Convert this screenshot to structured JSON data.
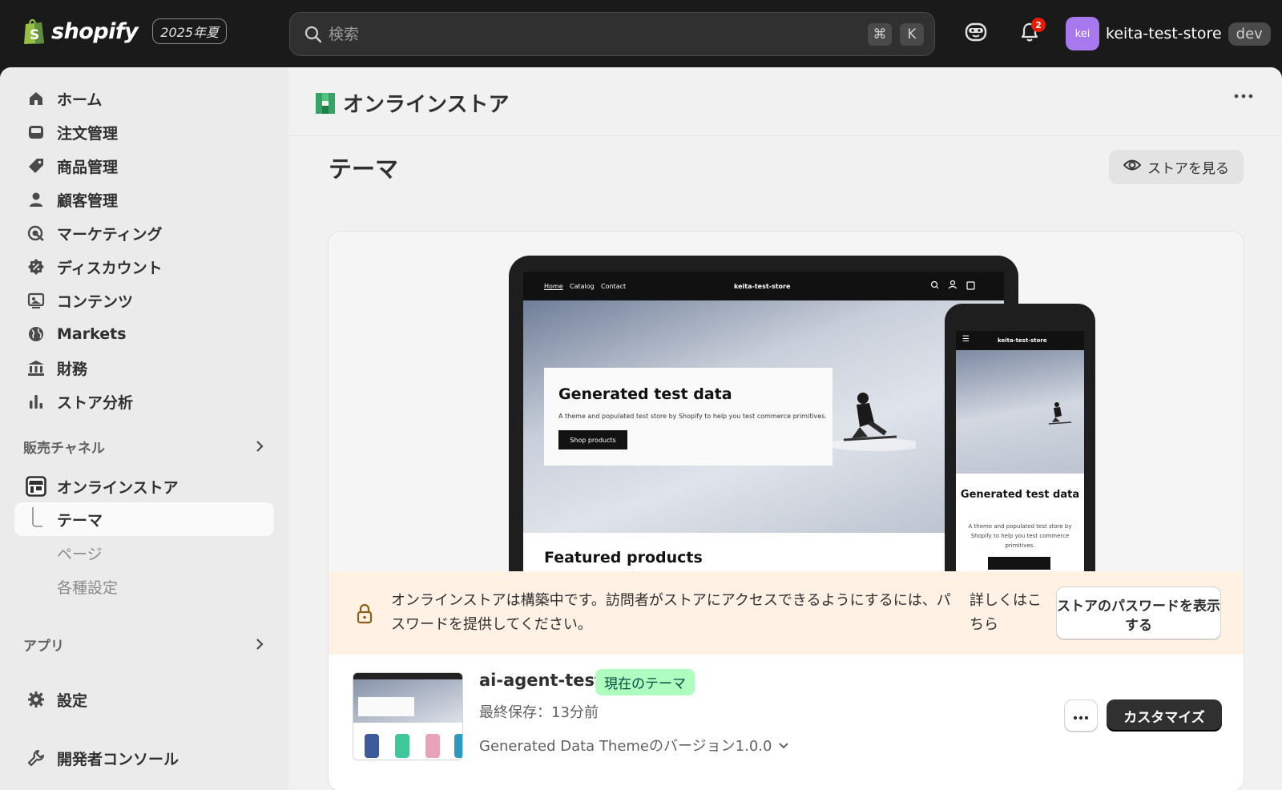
{
  "topbar": {
    "brand": "shopify",
    "edition": "2025年夏",
    "search_placeholder": "検索",
    "shortcut_mod": "⌘",
    "shortcut_key": "K",
    "notification_count": "2",
    "avatar_initials": "kei",
    "store_name": "keita-test-store",
    "env_badge": "dev"
  },
  "sidebar": {
    "items": [
      {
        "label": "ホーム",
        "icon": "home-icon"
      },
      {
        "label": "注文管理",
        "icon": "inbox-icon"
      },
      {
        "label": "商品管理",
        "icon": "tag-icon"
      },
      {
        "label": "顧客管理",
        "icon": "person-icon"
      },
      {
        "label": "マーケティング",
        "icon": "target-icon"
      },
      {
        "label": "ディスカウント",
        "icon": "discount-icon"
      },
      {
        "label": "コンテンツ",
        "icon": "content-icon"
      },
      {
        "label": "Markets",
        "icon": "globe-icon"
      },
      {
        "label": "財務",
        "icon": "bank-icon"
      },
      {
        "label": "ストア分析",
        "icon": "chart-bar-icon"
      }
    ],
    "sales_channels_heading": "販売チャネル",
    "online_store_label": "オンラインストア",
    "subitems": [
      {
        "label": "テーマ"
      },
      {
        "label": "ページ"
      },
      {
        "label": "各種設定"
      }
    ],
    "apps_heading": "アプリ",
    "settings_label": "設定",
    "dev_console_label": "開発者コンソール"
  },
  "page": {
    "header_title": "オンラインストア",
    "title": "テーマ",
    "view_store_label": "ストアを見る"
  },
  "preview": {
    "laptop_nav": {
      "home": "Home",
      "catalog": "Catalog",
      "contact": "Contact",
      "store": "keita-test-store"
    },
    "hero_title": "Generated test data",
    "hero_sub": "A theme and populated test store by Shopify to help you test commerce primitives.",
    "hero_button": "Shop products",
    "featured": "Featured products",
    "phone_store": "keita-test-store",
    "phone_title": "Generated test data",
    "phone_sub": "A theme and populated test store by Shopify to help you test commerce primitives."
  },
  "banner": {
    "text": "オンラインストアは構築中です。訪問者がストアにアクセスできるようにするには、パスワードを提供してください。",
    "link": "詳しくはこちら",
    "button": "ストアのパスワードを表示する"
  },
  "theme": {
    "name": "ai-agent-test",
    "badge": "現在のテーマ",
    "saved": "最終保存：13分前",
    "version": "Generated Data Themeのバージョン1.0.0",
    "customize": "カスタマイズ"
  }
}
